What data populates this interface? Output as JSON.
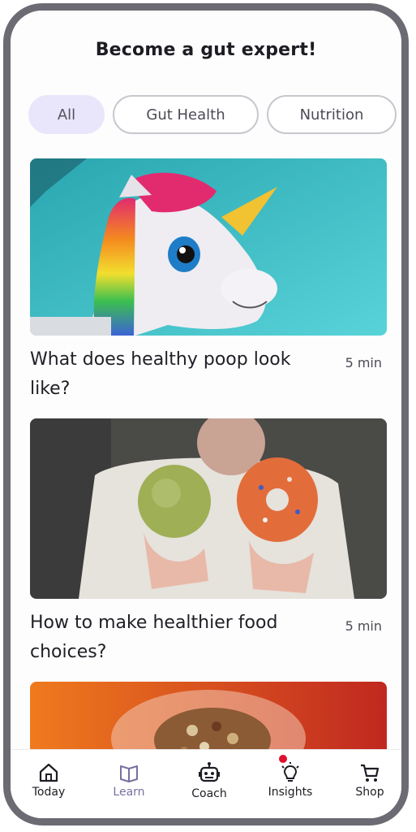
{
  "header": {
    "title": "Become a gut expert!"
  },
  "filters": [
    {
      "label": "All",
      "active": true
    },
    {
      "label": "Gut Health",
      "active": false
    },
    {
      "label": "Nutrition",
      "active": false
    }
  ],
  "articles": [
    {
      "title": "What does healthy poop look like?",
      "duration": "5 min",
      "image": "unicorn-float-in-pool"
    },
    {
      "title": "How to make healthier food choices?",
      "duration": "5 min",
      "image": "apple-and-donut-in-hands"
    },
    {
      "title": "",
      "duration": "",
      "image": "nuts-in-glass-bowl"
    }
  ],
  "tabbar": {
    "items": [
      {
        "label": "Today",
        "icon": "home-icon"
      },
      {
        "label": "Learn",
        "icon": "book-icon",
        "active": true
      },
      {
        "label": "Coach",
        "icon": "robot-icon"
      },
      {
        "label": "Insights",
        "icon": "lightbulb-icon",
        "notification": true
      },
      {
        "label": "Shop",
        "icon": "cart-icon"
      }
    ]
  },
  "colors": {
    "accent": "#e9e6fb",
    "frame": "#6c6b73",
    "notification": "#e0102e"
  }
}
